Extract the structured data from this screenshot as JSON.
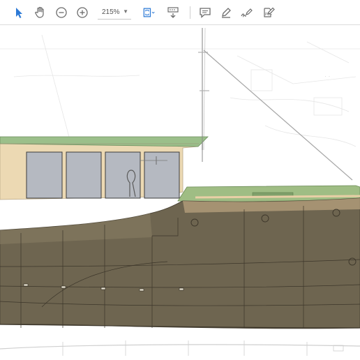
{
  "toolbar": {
    "zoom_value": "215%",
    "tools": [
      {
        "name": "select-tool",
        "icon": "arrow-cursor-icon"
      },
      {
        "name": "hand-tool",
        "icon": "hand-icon"
      },
      {
        "name": "zoom-out",
        "icon": "minus-circle-icon"
      },
      {
        "name": "zoom-in",
        "icon": "plus-circle-icon"
      },
      {
        "name": "fit-page",
        "icon": "fit-page-icon"
      },
      {
        "name": "scroll-mode",
        "icon": "scroll-mode-icon"
      },
      {
        "name": "comment",
        "icon": "comment-icon"
      },
      {
        "name": "highlight",
        "icon": "pen-icon"
      },
      {
        "name": "sign",
        "icon": "signature-icon"
      },
      {
        "name": "edit",
        "icon": "edit-pdf-icon"
      }
    ],
    "active_color": "#2d7ad6",
    "icon_color": "#6b6b6b"
  },
  "drawing": {
    "hull_color": "#6e6550",
    "cabin_color": "#ecd9b3",
    "roof_color": "#9bbf8a",
    "deck_color": "#9fbd84",
    "window_color": "#b5b9c1"
  }
}
